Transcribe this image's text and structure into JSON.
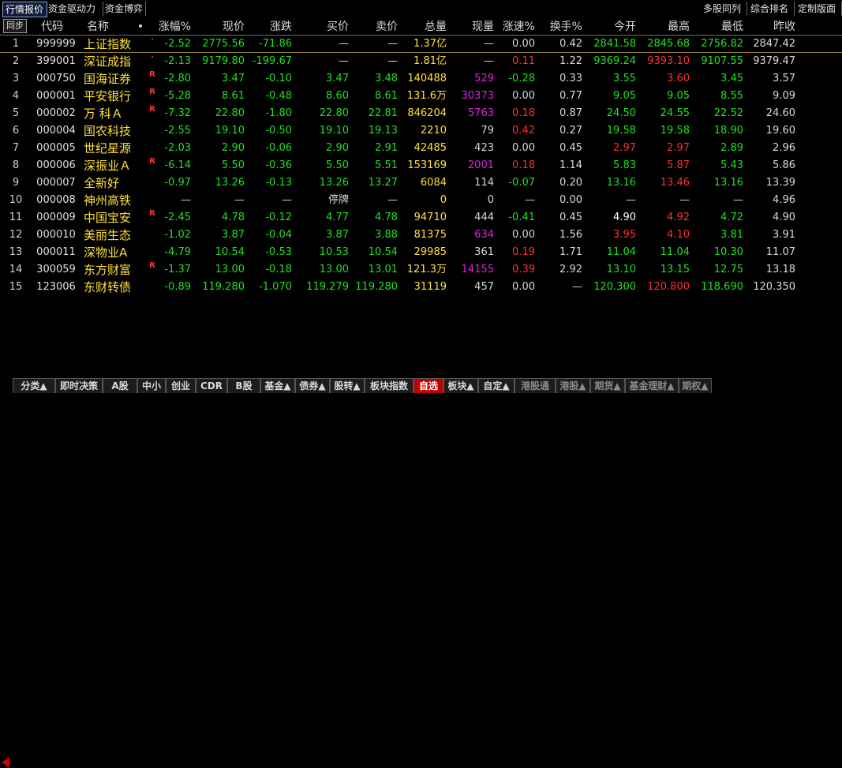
{
  "top_tabs_left": [
    "行情报价",
    "资金驱动力",
    "资金博弈"
  ],
  "top_tabs_right": [
    "多股同列",
    "综合排名",
    "定制版面"
  ],
  "sync_label": "同步",
  "columns": [
    "代码",
    "名称",
    "•",
    "涨幅%",
    "现价",
    "涨跌",
    "买价",
    "卖价",
    "总量",
    "现量",
    "涨速%",
    "换手%",
    "今开",
    "最高",
    "最低",
    "昨收"
  ],
  "rows": [
    {
      "idx": "1",
      "code": "999999",
      "name": "上证指数",
      "flag": "·",
      "pct": "-2.52",
      "price": "2775.56",
      "chg": "-71.86",
      "bid": "—",
      "ask": "—",
      "vol": "1.37亿",
      "cur": "—",
      "spd": "0.00",
      "turn": "0.42",
      "open": "2841.58",
      "high": "2845.68",
      "low": "2756.82",
      "prev": "2847.42",
      "cls": {
        "pct": "down",
        "price": "down",
        "chg": "down",
        "bid": "flat",
        "ask": "flat",
        "vol": "yel",
        "cur": "flat",
        "spd": "flat",
        "turn": "flat",
        "open": "down",
        "high": "down",
        "low": "down",
        "prev": "flat"
      }
    },
    {
      "idx": "2",
      "code": "399001",
      "name": "深证成指",
      "flag": "·",
      "pct": "-2.13",
      "price": "9179.80",
      "chg": "-199.67",
      "bid": "—",
      "ask": "—",
      "vol": "1.81亿",
      "cur": "—",
      "spd": "0.11",
      "turn": "1.22",
      "open": "9369.24",
      "high": "9393.10",
      "low": "9107.55",
      "prev": "9379.47",
      "cls": {
        "pct": "down",
        "price": "down",
        "chg": "down",
        "bid": "flat",
        "ask": "flat",
        "vol": "yel",
        "cur": "flat",
        "spd": "up",
        "turn": "flat",
        "open": "down",
        "high": "up",
        "low": "down",
        "prev": "flat"
      }
    },
    {
      "idx": "3",
      "code": "000750",
      "name": "国海证券",
      "flag": "R",
      "pct": "-2.80",
      "price": "3.47",
      "chg": "-0.10",
      "bid": "3.47",
      "ask": "3.48",
      "vol": "140488",
      "cur": "529",
      "spd": "-0.28",
      "turn": "0.33",
      "open": "3.55",
      "high": "3.60",
      "low": "3.45",
      "prev": "3.57",
      "cls": {
        "pct": "down",
        "price": "down",
        "chg": "down",
        "bid": "down",
        "ask": "down",
        "vol": "yel",
        "cur": "mag",
        "spd": "down",
        "turn": "flat",
        "open": "down",
        "high": "up",
        "low": "down",
        "prev": "flat"
      }
    },
    {
      "idx": "4",
      "code": "000001",
      "name": "平安银行",
      "flag": "R",
      "pct": "-5.28",
      "price": "8.61",
      "chg": "-0.48",
      "bid": "8.60",
      "ask": "8.61",
      "vol": "131.6万",
      "cur": "30373",
      "spd": "0.00",
      "turn": "0.77",
      "open": "9.05",
      "high": "9.05",
      "low": "8.55",
      "prev": "9.09",
      "cls": {
        "pct": "down",
        "price": "down",
        "chg": "down",
        "bid": "down",
        "ask": "down",
        "vol": "yel",
        "cur": "mag",
        "spd": "flat",
        "turn": "flat",
        "open": "down",
        "high": "down",
        "low": "down",
        "prev": "flat"
      }
    },
    {
      "idx": "5",
      "code": "000002",
      "name": "万 科Ａ",
      "flag": "R",
      "pct": "-7.32",
      "price": "22.80",
      "chg": "-1.80",
      "bid": "22.80",
      "ask": "22.81",
      "vol": "846204",
      "cur": "5763",
      "spd": "0.18",
      "turn": "0.87",
      "open": "24.50",
      "high": "24.55",
      "low": "22.52",
      "prev": "24.60",
      "cls": {
        "pct": "down",
        "price": "down",
        "chg": "down",
        "bid": "down",
        "ask": "down",
        "vol": "yel",
        "cur": "mag",
        "spd": "up",
        "turn": "flat",
        "open": "down",
        "high": "down",
        "low": "down",
        "prev": "flat"
      }
    },
    {
      "idx": "6",
      "code": "000004",
      "name": "国农科技",
      "flag": "",
      "pct": "-2.55",
      "price": "19.10",
      "chg": "-0.50",
      "bid": "19.10",
      "ask": "19.13",
      "vol": "2210",
      "cur": "79",
      "spd": "0.42",
      "turn": "0.27",
      "open": "19.58",
      "high": "19.58",
      "low": "18.90",
      "prev": "19.60",
      "cls": {
        "pct": "down",
        "price": "down",
        "chg": "down",
        "bid": "down",
        "ask": "down",
        "vol": "yel",
        "cur": "flat",
        "spd": "up",
        "turn": "flat",
        "open": "down",
        "high": "down",
        "low": "down",
        "prev": "flat"
      }
    },
    {
      "idx": "7",
      "code": "000005",
      "name": "世纪星源",
      "flag": "",
      "pct": "-2.03",
      "price": "2.90",
      "chg": "-0.06",
      "bid": "2.90",
      "ask": "2.91",
      "vol": "42485",
      "cur": "423",
      "spd": "0.00",
      "turn": "0.45",
      "open": "2.97",
      "high": "2.97",
      "low": "2.89",
      "prev": "2.96",
      "cls": {
        "pct": "down",
        "price": "down",
        "chg": "down",
        "bid": "down",
        "ask": "down",
        "vol": "yel",
        "cur": "flat",
        "spd": "flat",
        "turn": "flat",
        "open": "up",
        "high": "up",
        "low": "down",
        "prev": "flat"
      }
    },
    {
      "idx": "8",
      "code": "000006",
      "name": "深振业Ａ",
      "flag": "R",
      "pct": "-6.14",
      "price": "5.50",
      "chg": "-0.36",
      "bid": "5.50",
      "ask": "5.51",
      "vol": "153169",
      "cur": "2001",
      "spd": "0.18",
      "turn": "1.14",
      "open": "5.83",
      "high": "5.87",
      "low": "5.43",
      "prev": "5.86",
      "cls": {
        "pct": "down",
        "price": "down",
        "chg": "down",
        "bid": "down",
        "ask": "down",
        "vol": "yel",
        "cur": "mag",
        "spd": "up",
        "turn": "flat",
        "open": "down",
        "high": "up",
        "low": "down",
        "prev": "flat"
      }
    },
    {
      "idx": "9",
      "code": "000007",
      "name": "全新好",
      "flag": "",
      "pct": "-0.97",
      "price": "13.26",
      "chg": "-0.13",
      "bid": "13.26",
      "ask": "13.27",
      "vol": "6084",
      "cur": "114",
      "spd": "-0.07",
      "turn": "0.20",
      "open": "13.16",
      "high": "13.46",
      "low": "13.16",
      "prev": "13.39",
      "cls": {
        "pct": "down",
        "price": "down",
        "chg": "down",
        "bid": "down",
        "ask": "down",
        "vol": "yel",
        "cur": "flat",
        "spd": "down",
        "turn": "flat",
        "open": "down",
        "high": "up",
        "low": "down",
        "prev": "flat"
      }
    },
    {
      "idx": "10",
      "code": "000008",
      "name": "神州高铁",
      "flag": "",
      "pct": "—",
      "price": "—",
      "chg": "—",
      "bid": "停牌",
      "ask": "—",
      "vol": "0",
      "cur": "0",
      "spd": "—",
      "turn": "0.00",
      "open": "—",
      "high": "—",
      "low": "—",
      "prev": "4.96",
      "cls": {
        "pct": "flat",
        "price": "flat",
        "chg": "flat",
        "bid": "flat",
        "ask": "flat",
        "vol": "yel",
        "cur": "flat",
        "spd": "flat",
        "turn": "flat",
        "open": "flat",
        "high": "flat",
        "low": "flat",
        "prev": "flat"
      }
    },
    {
      "idx": "11",
      "code": "000009",
      "name": "中国宝安",
      "flag": "R",
      "pct": "-2.45",
      "price": "4.78",
      "chg": "-0.12",
      "bid": "4.77",
      "ask": "4.78",
      "vol": "94710",
      "cur": "444",
      "spd": "-0.41",
      "turn": "0.45",
      "open": "4.90",
      "high": "4.92",
      "low": "4.72",
      "prev": "4.90",
      "cls": {
        "pct": "down",
        "price": "down",
        "chg": "down",
        "bid": "down",
        "ask": "down",
        "vol": "yel",
        "cur": "flat",
        "spd": "down",
        "turn": "flat",
        "open": "wht",
        "high": "up",
        "low": "down",
        "prev": "flat"
      }
    },
    {
      "idx": "12",
      "code": "000010",
      "name": "美丽生态",
      "flag": "",
      "pct": "-1.02",
      "price": "3.87",
      "chg": "-0.04",
      "bid": "3.87",
      "ask": "3.88",
      "vol": "81375",
      "cur": "634",
      "spd": "0.00",
      "turn": "1.56",
      "open": "3.95",
      "high": "4.10",
      "low": "3.81",
      "prev": "3.91",
      "cls": {
        "pct": "down",
        "price": "down",
        "chg": "down",
        "bid": "down",
        "ask": "down",
        "vol": "yel",
        "cur": "mag",
        "spd": "flat",
        "turn": "flat",
        "open": "up",
        "high": "up",
        "low": "down",
        "prev": "flat"
      }
    },
    {
      "idx": "13",
      "code": "000011",
      "name": "深物业A",
      "flag": "",
      "pct": "-4.79",
      "price": "10.54",
      "chg": "-0.53",
      "bid": "10.53",
      "ask": "10.54",
      "vol": "29985",
      "cur": "361",
      "spd": "0.19",
      "turn": "1.71",
      "open": "11.04",
      "high": "11.04",
      "low": "10.30",
      "prev": "11.07",
      "cls": {
        "pct": "down",
        "price": "down",
        "chg": "down",
        "bid": "down",
        "ask": "down",
        "vol": "yel",
        "cur": "flat",
        "spd": "up",
        "turn": "flat",
        "open": "down",
        "high": "down",
        "low": "down",
        "prev": "flat"
      }
    },
    {
      "idx": "14",
      "code": "300059",
      "name": "东方财富",
      "flag": "R",
      "pct": "-1.37",
      "price": "13.00",
      "chg": "-0.18",
      "bid": "13.00",
      "ask": "13.01",
      "vol": "121.3万",
      "cur": "14155",
      "spd": "0.39",
      "turn": "2.92",
      "open": "13.10",
      "high": "13.15",
      "low": "12.75",
      "prev": "13.18",
      "cls": {
        "pct": "down",
        "price": "down",
        "chg": "down",
        "bid": "down",
        "ask": "down",
        "vol": "yel",
        "cur": "mag",
        "spd": "up",
        "turn": "flat",
        "open": "down",
        "high": "down",
        "low": "down",
        "prev": "flat"
      }
    },
    {
      "idx": "15",
      "code": "123006",
      "name": "东财转债",
      "flag": "",
      "pct": "-0.89",
      "price": "119.280",
      "chg": "-1.070",
      "bid": "119.279",
      "ask": "119.280",
      "vol": "31119",
      "cur": "457",
      "spd": "0.00",
      "turn": "—",
      "open": "120.300",
      "high": "120.800",
      "low": "118.690",
      "prev": "120.350",
      "cls": {
        "pct": "down",
        "price": "down",
        "chg": "down",
        "bid": "down",
        "ask": "down",
        "vol": "yel",
        "cur": "flat",
        "spd": "flat",
        "turn": "flat",
        "open": "down",
        "high": "up",
        "low": "down",
        "prev": "flat"
      }
    }
  ],
  "bottom_tabs": [
    {
      "label": "分类▲",
      "state": "normal"
    },
    {
      "label": "即时决策",
      "state": "normal"
    },
    {
      "label": "A股",
      "state": "normal"
    },
    {
      "label": "中小",
      "state": "normal"
    },
    {
      "label": "创业",
      "state": "normal"
    },
    {
      "label": "CDR",
      "state": "normal"
    },
    {
      "label": "B股",
      "state": "normal"
    },
    {
      "label": "基金▲",
      "state": "normal"
    },
    {
      "label": "债券▲",
      "state": "normal"
    },
    {
      "label": "股转▲",
      "state": "normal"
    },
    {
      "label": "板块指数",
      "state": "normal"
    },
    {
      "label": "自选",
      "state": "active"
    },
    {
      "label": "板块▲",
      "state": "normal"
    },
    {
      "label": "自定▲",
      "state": "normal"
    },
    {
      "label": "港股通",
      "state": "dim"
    },
    {
      "label": "港股▲",
      "state": "dim"
    },
    {
      "label": "期货▲",
      "state": "dim"
    },
    {
      "label": "基金理财▲",
      "state": "dim"
    },
    {
      "label": "期权▲",
      "state": "dim"
    }
  ],
  "colors": {
    "up": "#ff3030",
    "down": "#20e020",
    "volume": "#ffe03a",
    "curvol": "#e020e0",
    "active_tab": "#c00000"
  }
}
